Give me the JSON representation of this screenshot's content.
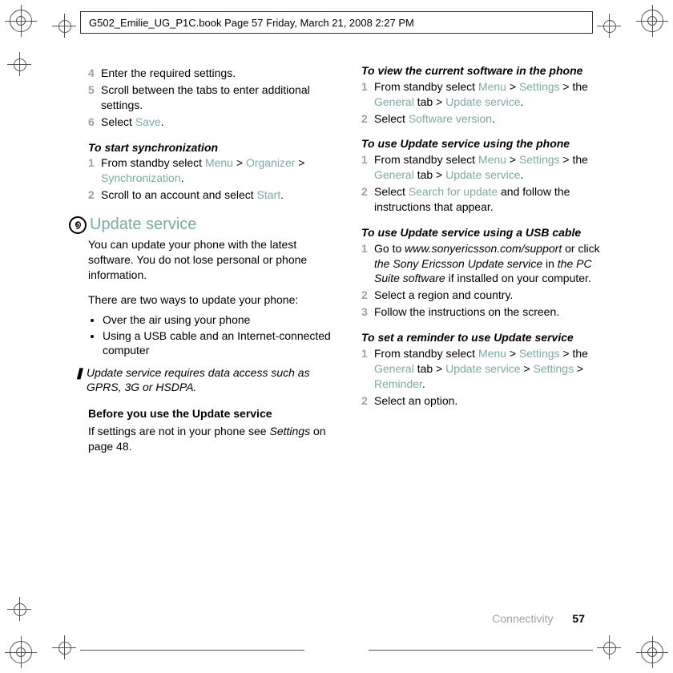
{
  "header": {
    "text": "G502_Emilie_UG_P1C.book  Page 57  Friday, March 21, 2008  2:27 PM"
  },
  "footer": {
    "section": "Connectivity",
    "page_number": "57"
  },
  "left_column": {
    "pre_steps": {
      "s4": "Enter the required settings.",
      "s5": "Scroll between the tabs to enter additional settings.",
      "s6_a": "Select ",
      "s6_b": "Save",
      "s6_c": "."
    },
    "sync": {
      "heading": "To start synchronization",
      "s1_a": "From standby select ",
      "s1_menu": "Menu",
      "s1_gt1": " > ",
      "s1_org": "Organizer",
      "s1_gt2": " > ",
      "s1_sync": "Synchronization",
      "s1_end": ".",
      "s2_a": "Scroll to an account and select ",
      "s2_b": "Start",
      "s2_c": "."
    },
    "update": {
      "title": "Update service",
      "p1": "You can update your phone with the latest software. You do not lose personal or phone information.",
      "p2": "There are two ways to update your phone:",
      "b1": "Over the air using your phone",
      "b2": "Using a USB cable and an Internet-connected computer",
      "note": "Update service requires data access such as GPRS, 3G or HSDPA.",
      "before_head": "Before you use the Update service",
      "before_a": "If settings are not in your phone see ",
      "before_b": "Settings",
      "before_c": " on page 48."
    }
  },
  "right_column": {
    "view_sw": {
      "heading": "To view the current software in the phone",
      "s1_a": "From standby select ",
      "s1_menu": "Menu",
      "gt": " > ",
      "s1_settings": "Settings",
      "s1_mid": " > the ",
      "s1_general": "General",
      "s1_tab": " tab > ",
      "s1_update": "Update service",
      "dot": ".",
      "s2_a": "Select ",
      "s2_b": "Software version"
    },
    "use_phone": {
      "heading": "To use Update service using the phone",
      "s1_a": "From standby select ",
      "s1_menu": "Menu",
      "gt": " > ",
      "s1_settings": "Settings",
      "s1_mid": " > the ",
      "s1_general": "General",
      "s1_tab": " tab > ",
      "s1_update": "Update service",
      "dot": ".",
      "s2_a": "Select ",
      "s2_b": "Search for update",
      "s2_c": " and follow the instructions that appear."
    },
    "use_usb": {
      "heading": "To use Update service using a USB cable",
      "s1_a": "Go to ",
      "s1_url": "www.sonyericsson.com/support",
      "s1_b": " or click ",
      "s1_c": "the Sony Ericsson Update service",
      "s1_d": " in ",
      "s1_e": "the PC Suite software",
      "s1_f": " if installed on your computer.",
      "s2": "Select a region and country.",
      "s3": "Follow the instructions on the screen."
    },
    "reminder": {
      "heading": "To set a reminder to use Update service",
      "s1_a": "From standby select ",
      "s1_menu": "Menu",
      "gt": " > ",
      "s1_settings": "Settings",
      "s1_mid": " > the ",
      "s1_general": "General",
      "s1_tab": " tab > ",
      "s1_update": "Update service",
      "s1_gt2": " > ",
      "s1_set2": "Settings",
      "s1_gt3": " > ",
      "s1_rem": "Reminder",
      "dot": ".",
      "s2": "Select an option."
    }
  },
  "nums": {
    "n1": "1",
    "n2": "2",
    "n3": "3",
    "n4": "4",
    "n5": "5",
    "n6": "6"
  }
}
